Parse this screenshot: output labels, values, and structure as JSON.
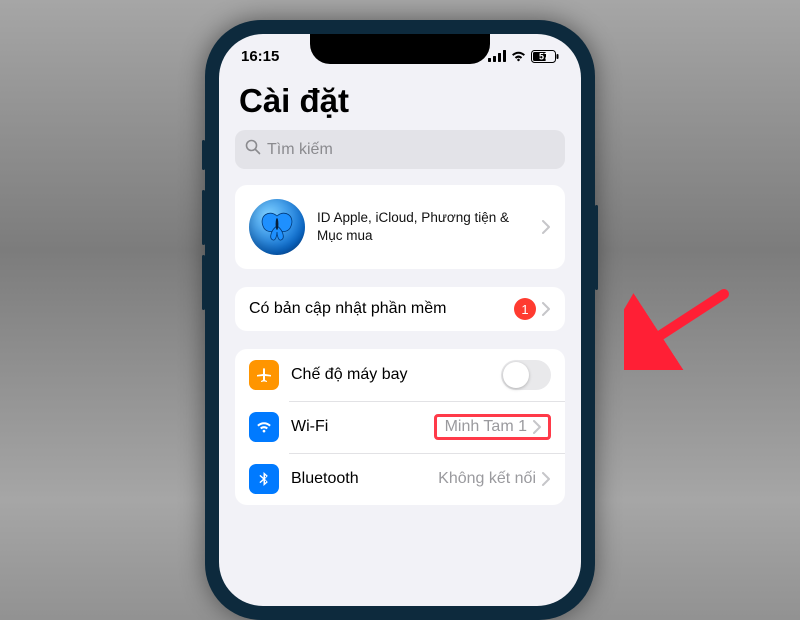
{
  "status": {
    "time": "16:15",
    "battery": "57"
  },
  "title": "Cài đặt",
  "search": {
    "placeholder": "Tìm kiếm"
  },
  "appleId": {
    "subtitle": "ID Apple, iCloud, Phương tiện & Mục mua"
  },
  "update": {
    "label": "Có bản cập nhật phần mềm",
    "badge": "1"
  },
  "rows": {
    "airplane": {
      "label": "Chế độ máy bay"
    },
    "wifi": {
      "label": "Wi-Fi",
      "detail": "Minh Tam 1"
    },
    "bluetooth": {
      "label": "Bluetooth",
      "detail": "Không kết nối"
    }
  }
}
